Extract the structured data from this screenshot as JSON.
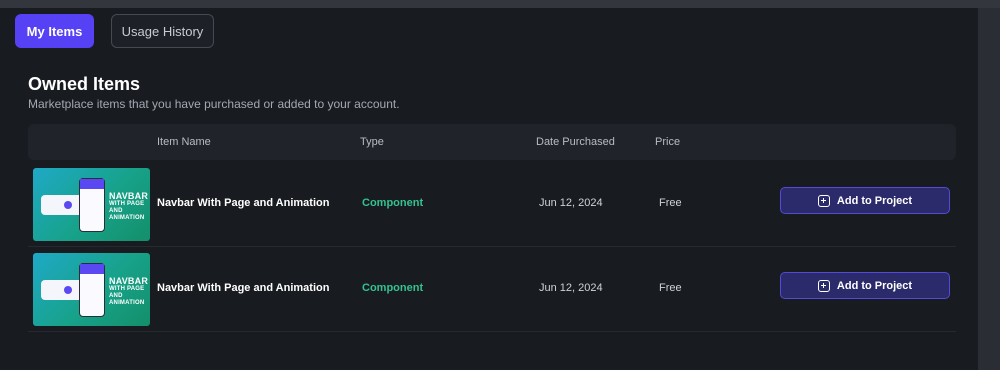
{
  "tabs": [
    {
      "label": "My Items",
      "active": true
    },
    {
      "label": "Usage History",
      "active": false
    }
  ],
  "owned_section": {
    "title": "Owned Items",
    "subtitle": "Marketplace items that you have purchased or added to your account."
  },
  "table": {
    "columns": [
      "Item Name",
      "Type",
      "Date Purchased",
      "Price"
    ],
    "rows": [
      {
        "name": "Navbar With Page and Animation",
        "type": "Component",
        "date": "Jun 12, 2024",
        "price": "Free",
        "action": "Add to Project",
        "thumbnail_text": [
          "NAVBAR",
          "WITH PAGE",
          "AND",
          "ANIMATION"
        ]
      },
      {
        "name": "Navbar With Page and Animation",
        "type": "Component",
        "date": "Jun 12, 2024",
        "price": "Free",
        "action": "Add to Project",
        "thumbnail_text": [
          "NAVBAR",
          "WITH PAGE",
          "AND",
          "ANIMATION"
        ]
      }
    ]
  },
  "colors": {
    "accent": "#5641f5",
    "component_type": "#35c28f",
    "button_bg": "#2b2a6a"
  }
}
